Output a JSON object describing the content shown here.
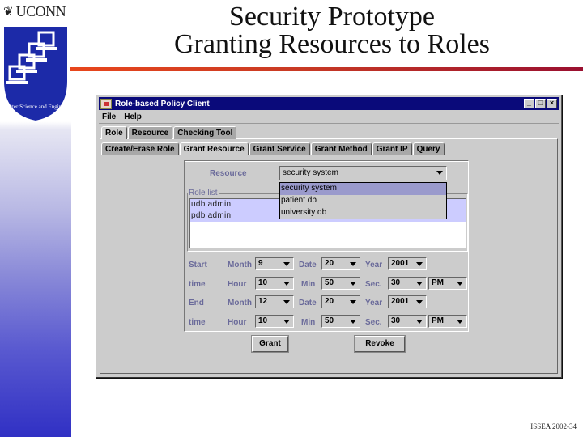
{
  "slide": {
    "title_line1": "Security Prototype",
    "title_line2": "Granting Resources to Roles",
    "logo_text": "UCONN",
    "logo_glyph": "❦",
    "shield_caption": "Computer Science and Engineering",
    "footer": "ISSEA 2002-34",
    "colors": {
      "rule_start": "#e8461c",
      "rule_end": "#9a1030",
      "sidebar_bottom": "#3030c4"
    }
  },
  "window": {
    "title": "Role-based Policy Client",
    "controls": {
      "minimize": "_",
      "maximize": "□",
      "close": "×"
    },
    "menu": [
      "File",
      "Help"
    ],
    "tabs": [
      "Role",
      "Resource",
      "Checking Tool"
    ],
    "active_tab": "Role",
    "subtabs": [
      "Create/Erase Role",
      "Grant Resource",
      "Grant Service",
      "Grant Method",
      "Grant IP",
      "Query"
    ],
    "active_subtab": "Grant Resource"
  },
  "form": {
    "resource_label": "Resource",
    "resource_value": "security system",
    "resource_options": [
      "security system",
      "patient db",
      "university db"
    ],
    "role_list_title": "Role list",
    "roles": [
      "udb admin",
      "pdb admin"
    ],
    "start": {
      "label": "Start",
      "month_label": "Month",
      "month": "9",
      "date_label": "Date",
      "date": "20",
      "year_label": "Year",
      "year": "2001"
    },
    "start_time": {
      "label": "time",
      "hour_label": "Hour",
      "hour": "10",
      "min_label": "Min",
      "min": "50",
      "sec_label": "Sec.",
      "sec": "30",
      "ampm": "PM"
    },
    "end": {
      "label": "End",
      "month_label": "Month",
      "month": "12",
      "date_label": "Date",
      "date": "20",
      "year_label": "Year",
      "year": "2001"
    },
    "end_time": {
      "label": "time",
      "hour_label": "Hour",
      "hour": "10",
      "min_label": "Min",
      "min": "50",
      "sec_label": "Sec.",
      "sec": "30",
      "ampm": "PM"
    },
    "grant_button": "Grant",
    "revoke_button": "Revoke"
  }
}
